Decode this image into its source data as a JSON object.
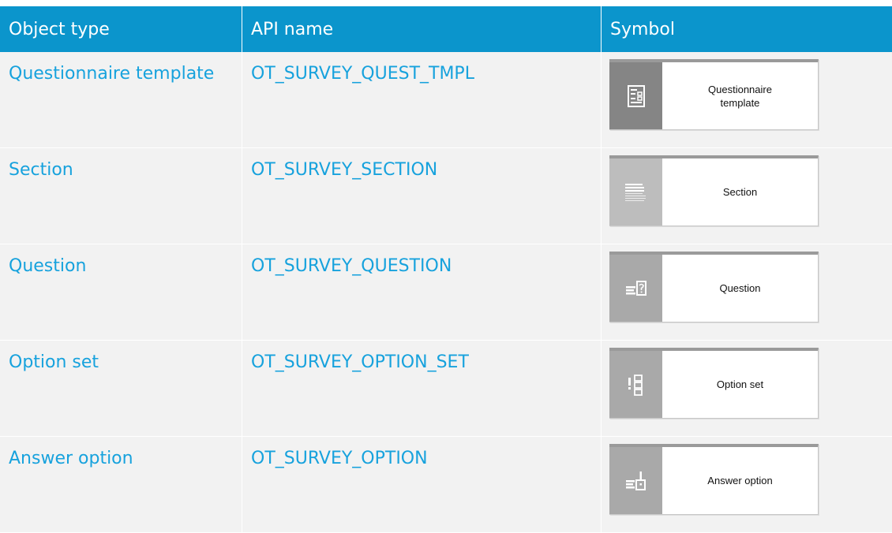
{
  "header": {
    "col1": "Object type",
    "col2": "API name",
    "col3": "Symbol"
  },
  "rows": [
    {
      "object_type": "Questionnaire template",
      "api_name": "OT_SURVEY_QUEST_TMPL",
      "symbol_label": "Questionnaire\ntemplate",
      "symbol_icon": "questionnaire-template-icon"
    },
    {
      "object_type": "Section",
      "api_name": "OT_SURVEY_SECTION",
      "symbol_label": "Section",
      "symbol_icon": "section-icon"
    },
    {
      "object_type": "Question",
      "api_name": "OT_SURVEY_QUESTION",
      "symbol_label": "Question",
      "symbol_icon": "question-icon"
    },
    {
      "object_type": "Option set",
      "api_name": "OT_SURVEY_OPTION_SET",
      "symbol_label": "Option set",
      "symbol_icon": "option-set-icon"
    },
    {
      "object_type": "Answer option",
      "api_name": "OT_SURVEY_OPTION",
      "symbol_label": "Answer option",
      "symbol_icon": "answer-option-icon"
    }
  ],
  "colors": {
    "header_bg": "#0b95cc",
    "link": "#17a2dd",
    "row_bg": "#f2f2f2"
  }
}
